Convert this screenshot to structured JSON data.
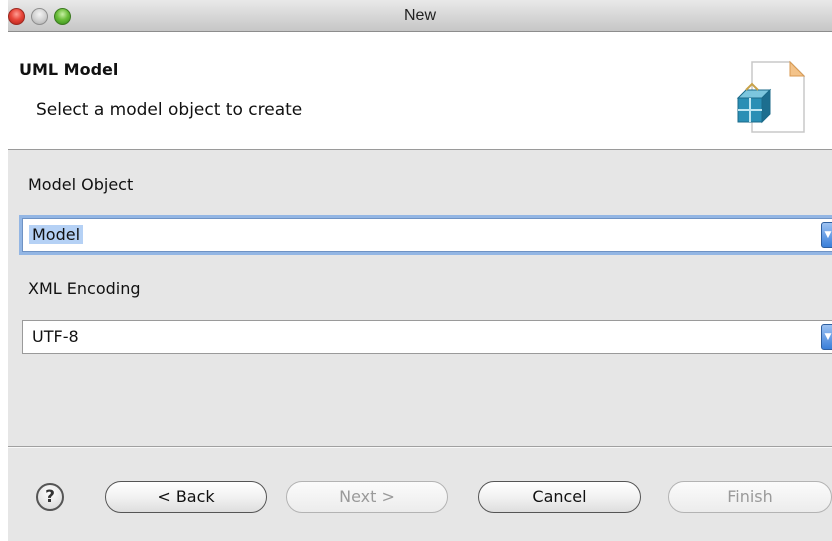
{
  "window": {
    "title": "New"
  },
  "header": {
    "title": "UML Model",
    "description": "Select a model object to create",
    "icon": "uml-model-wizard-icon"
  },
  "form": {
    "model_object_label": "Model Object",
    "model_object_value": "Model",
    "xml_encoding_label": "XML Encoding",
    "xml_encoding_value": "UTF-8"
  },
  "buttons": {
    "help": "?",
    "back": "< Back",
    "next": "Next >",
    "cancel": "Cancel",
    "finish": "Finish"
  },
  "colors": {
    "focus_ring": "#93b6e4",
    "selection": "#b5d1f5",
    "dropdown_arrow": "#3a7fd9"
  }
}
